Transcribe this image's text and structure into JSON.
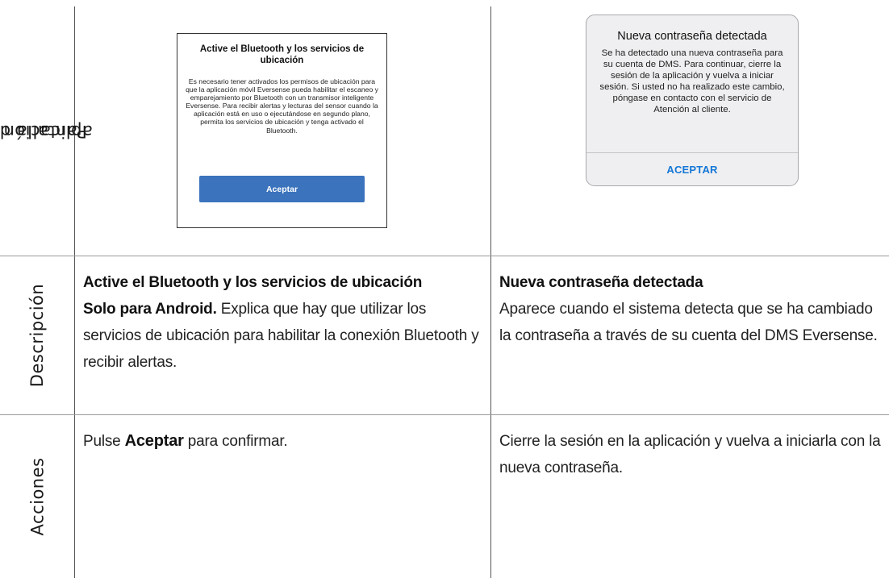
{
  "rows": {
    "screen_label": "Pantalla de la aplicación",
    "screen_label_line1": "Pantalla de la",
    "screen_label_line2": "aplicación",
    "description_label": "Descripción",
    "actions_label": "Acciones"
  },
  "android_dialog": {
    "title": "Active el Bluetooth y los servicios de ubicación",
    "body": "Es necesario tener activados los permisos de ubicación para que la aplicación móvil Eversense pueda habilitar el escaneo y emparejamiento por Bluetooth con un transmisor inteligente Eversense. Para recibir alertas y lecturas del sensor cuando la aplicación está en uso o ejecutándose en segundo plano, permita los servicios de ubicación y tenga activado el Bluetooth.",
    "button": "Aceptar",
    "button_color": "#3b73bd"
  },
  "ios_alert": {
    "title": "Nueva contraseña detectada",
    "body": "Se ha detectado una nueva contraseña para su cuenta de DMS. Para continuar, cierre la sesión de la aplicación y vuelva a iniciar sesión. Si usted no ha realizado este cambio, póngase en contacto con el servicio de Atención al cliente.",
    "button": "ACEPTAR",
    "button_color": "#1577d6"
  },
  "col1": {
    "desc_title": "Active el Bluetooth y los servicios de ubicación",
    "desc_lead": "Solo para Android.",
    "desc_text": "Explica que hay que utilizar los servicios de ubicación para habilitar la conexión Bluetooth y recibir alertas.",
    "action_prefix": "Pulse",
    "action_bold": "Aceptar",
    "action_suffix": "para confirmar."
  },
  "col2": {
    "desc_title": "Nueva contraseña detectada",
    "desc_text": "Aparece cuando el sistema detecta que se ha cambiado la contraseña a través de su cuenta del DMS Eversense.",
    "action_text": "Cierre la sesión en la aplicación y vuelva a iniciarla con la nueva contraseña."
  }
}
